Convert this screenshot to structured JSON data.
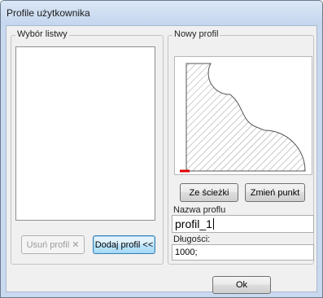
{
  "window": {
    "title": "Profile użytkownika"
  },
  "left_group": {
    "label": "Wybór listwy",
    "remove_button": "Usuń profil ✕",
    "add_button": "Dodaj profil <<"
  },
  "right_group": {
    "label": "Nowy profil",
    "from_path_button": "Ze ścieżki",
    "change_point_button": "Zmień punkt",
    "profile_name_label": "Nazwa proflu",
    "profile_name_value": "profil_1",
    "lengths_label": "Długości:",
    "lengths_value": "1000;"
  },
  "ok_button": "Ok",
  "colors": {
    "start_point_marker": "#e00000",
    "profile_outline": "#555555",
    "titlebar": "#c9daf0"
  }
}
